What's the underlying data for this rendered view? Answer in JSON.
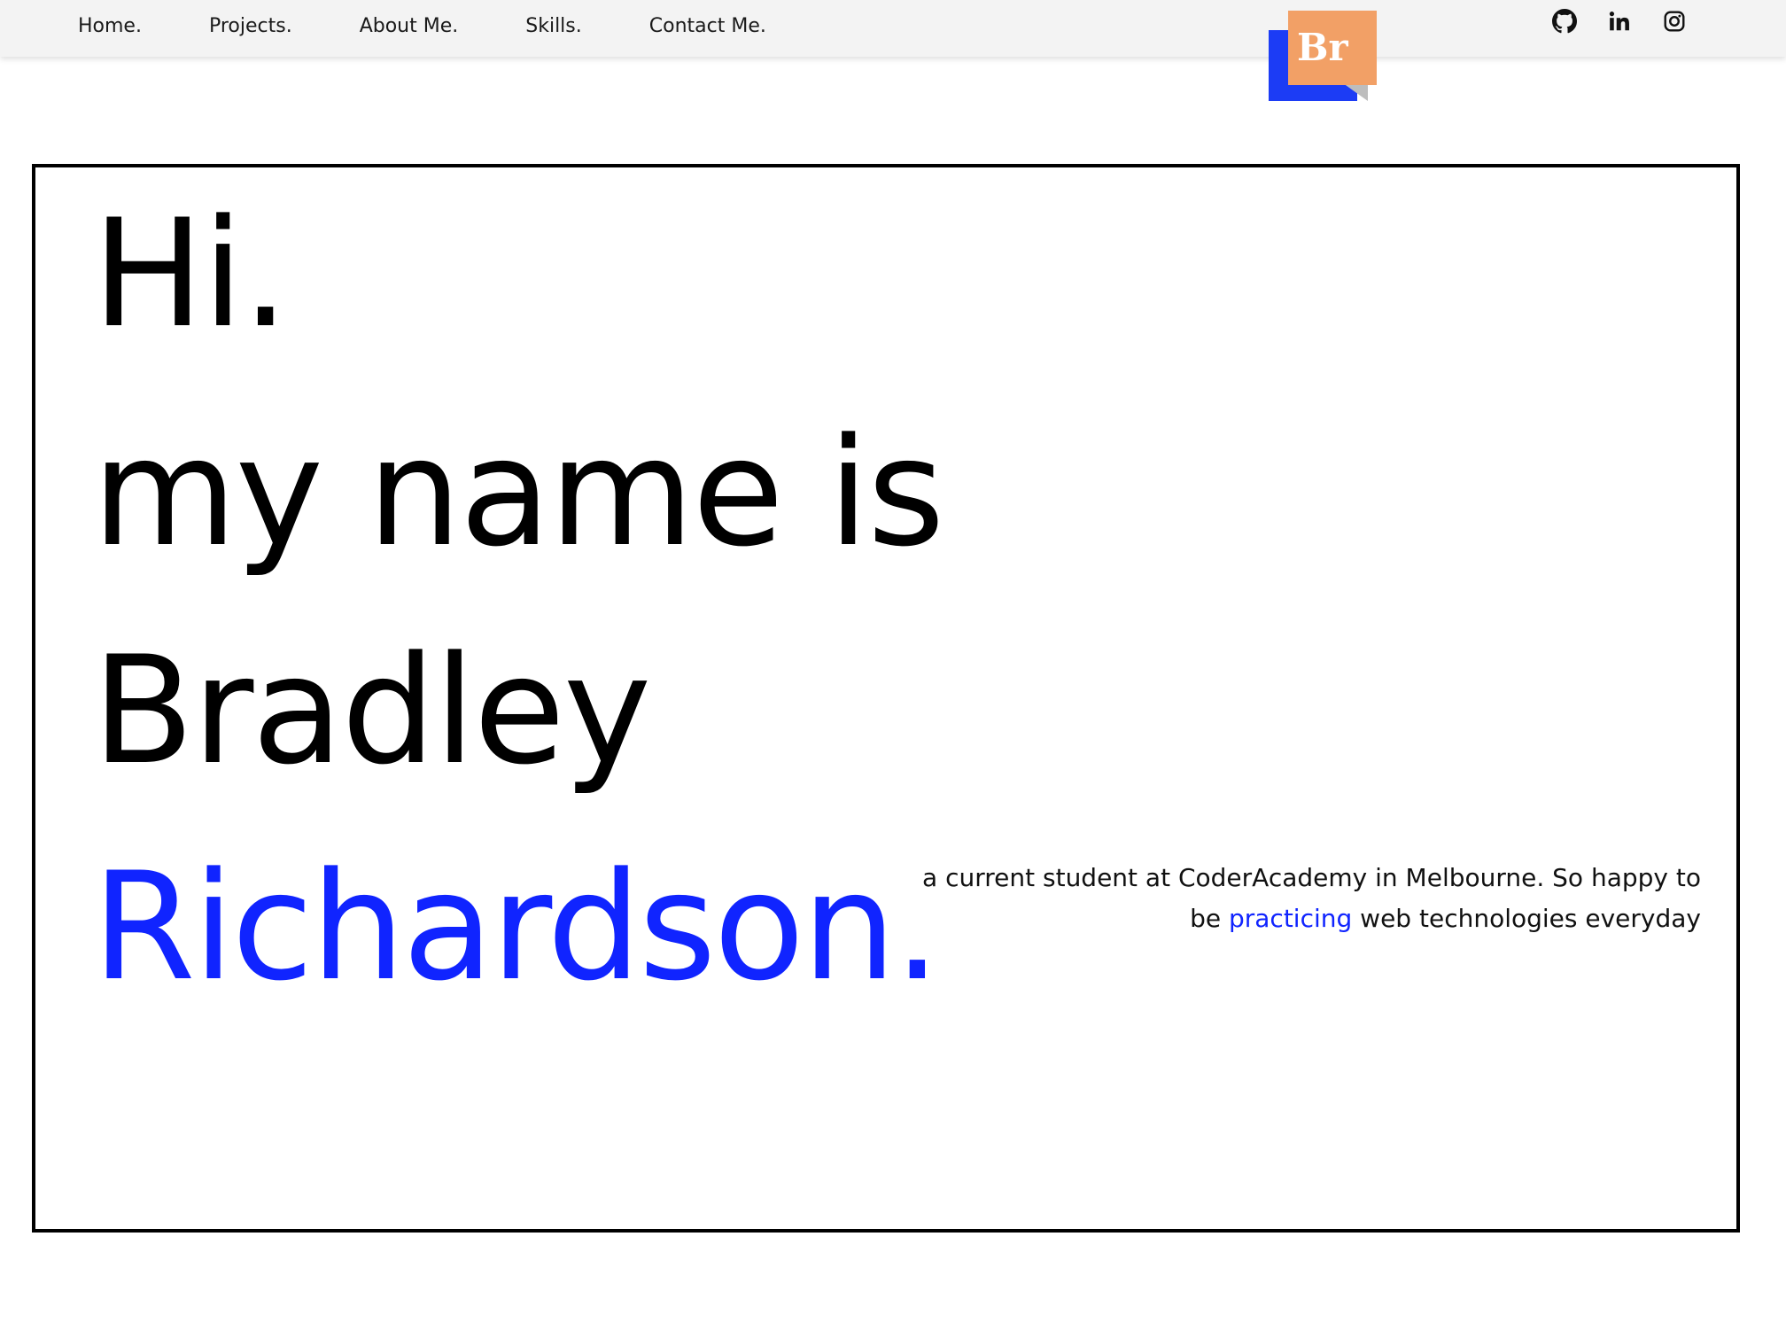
{
  "nav": {
    "links": [
      "Home.",
      "Projects.",
      "About Me.",
      "Skills.",
      "Contact Me."
    ]
  },
  "logo": {
    "text": "Br",
    "colors": {
      "front": "#f2a066",
      "back": "#1c3cf5"
    }
  },
  "social": {
    "icons": [
      "github-icon",
      "linkedin-icon",
      "instagram-icon"
    ]
  },
  "hero": {
    "greeting": "Hi.",
    "intro": "my name is",
    "first_name": "Bradley",
    "last_name": "Richardson.",
    "tagline_part1": "a current student at CoderAcademy in Melbourne. So happy to be ",
    "tagline_highlight": "practicing",
    "tagline_part2": " web technologies everyday",
    "accent_color": "#1024ff"
  }
}
